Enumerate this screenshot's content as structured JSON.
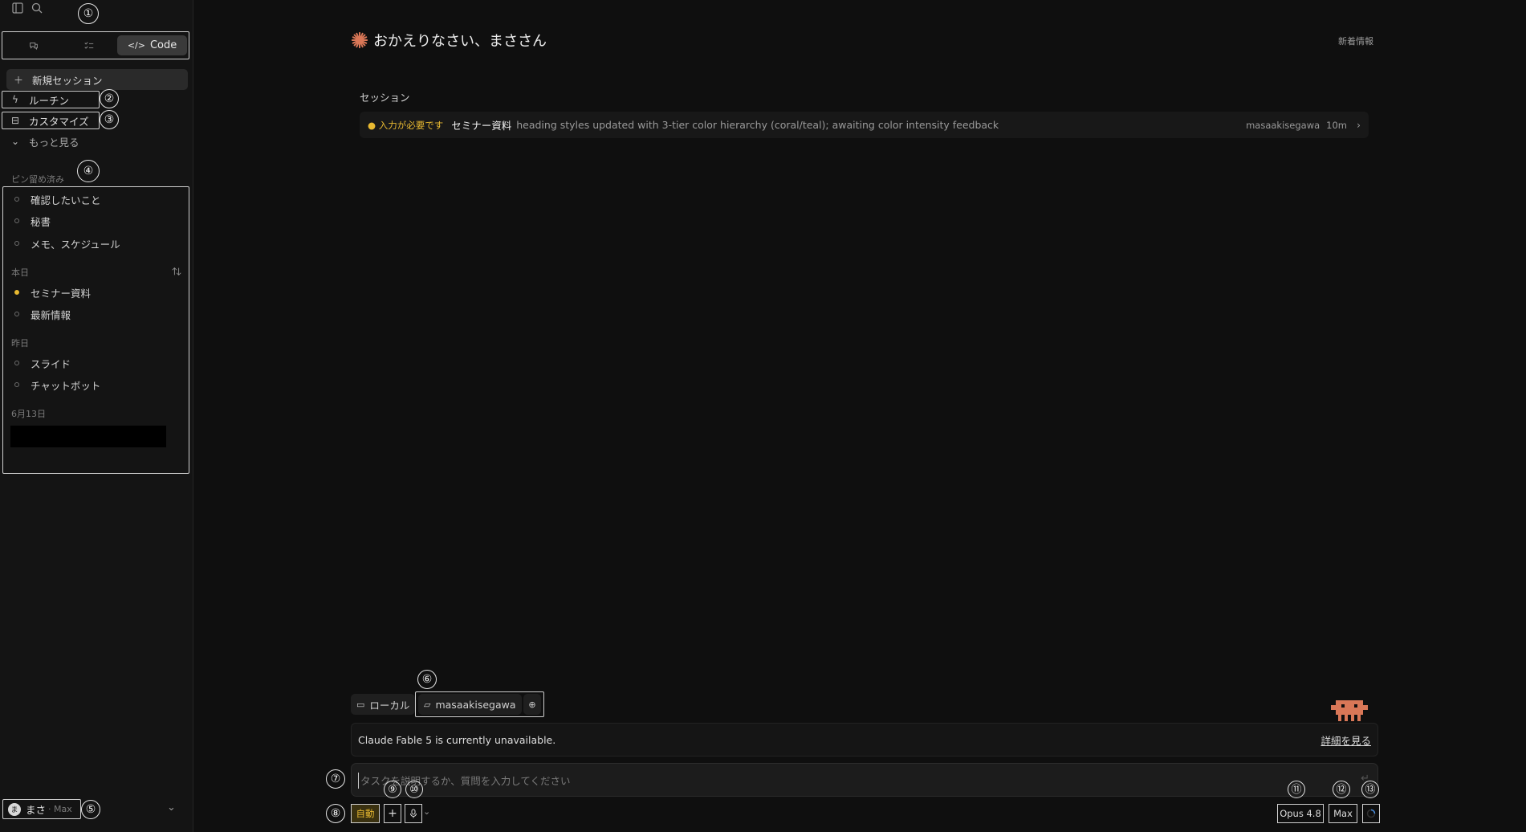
{
  "annotations": [
    "①",
    "②",
    "③",
    "④",
    "⑤",
    "⑥",
    "⑦",
    "⑧",
    "⑨",
    "⑩",
    "⑪",
    "⑫",
    "⑬"
  ],
  "sidebar": {
    "mode_tabs": [
      {
        "label": "",
        "icon": "chat-icon"
      },
      {
        "label": "",
        "icon": "tasks-icon"
      },
      {
        "label": "Code",
        "icon": "code-icon"
      }
    ],
    "new_session": "新規セッション",
    "routines": "ルーチン",
    "customize": "カスタマイズ",
    "more": "もっと見る",
    "pinned_label": "ピン留め済み",
    "pinned": [
      "確認したいこと",
      "秘書",
      "メモ、スケジュール"
    ],
    "today_label": "本日",
    "today": [
      "セミナー資料",
      "最新情報"
    ],
    "yesterday_label": "昨日",
    "yesterday": [
      "スライド",
      "チャットボット"
    ],
    "date_label": "6月13日",
    "user": {
      "avatar": "ま",
      "name": "まさ",
      "plan": "· Max"
    }
  },
  "main": {
    "greeting": "おかえりなさい、まささん",
    "news": "新着情報",
    "sessions_label": "セッション",
    "session": {
      "status": "● 入力が必要です",
      "title": "セミナー資料",
      "desc": "heading styles updated with 3-tier color hierarchy (coral/teal); awaiting color intensity feedback",
      "user": "masaakisegawa",
      "time": "10m",
      "chevron": "›"
    }
  },
  "composer": {
    "env": "ローカル",
    "folder": "masaakisegawa",
    "notice": "Claude Fable 5 is currently unavailable.",
    "notice_link": "詳細を見る",
    "placeholder": "タスクを説明するか、質問を入力してください",
    "mode": "自動",
    "add": "+",
    "model": "Opus 4.8",
    "effort": "Max"
  },
  "colors": {
    "accent": "#e8b931",
    "brand": "#d97757"
  }
}
